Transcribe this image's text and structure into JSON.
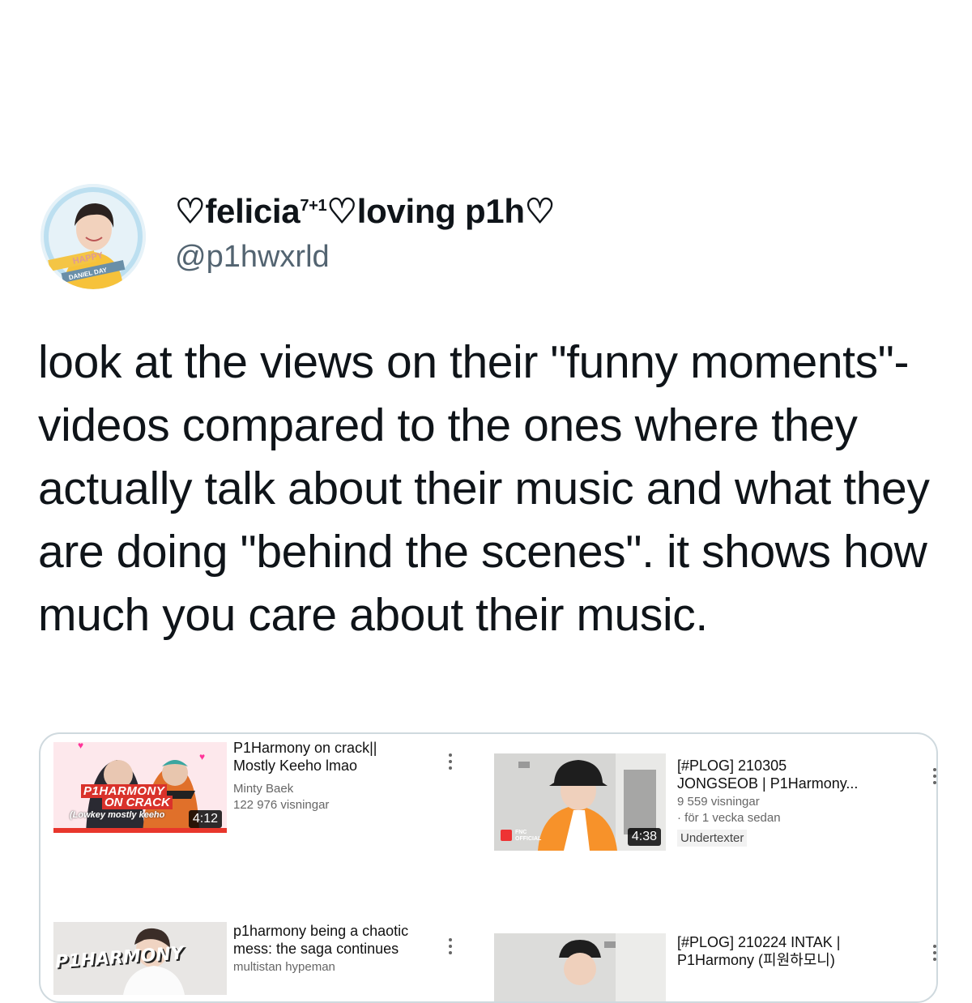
{
  "tweet": {
    "display_name": "♡felicia",
    "display_name_sup": "7+1",
    "display_name_rest": "♡loving p1h♡",
    "handle": "@p1hwxrld",
    "avatar_badge_top": "HAPPY",
    "avatar_badge_bottom": "DANIEL DAY",
    "text": "look at the views on their \"funny moments\"-videos compared to the ones where they actually talk about their music and what they are doing \"behind the scenes\". it shows how much you care about their music."
  },
  "videos": [
    {
      "title": "P1Harmony on crack||\nMostly Keeho lmao",
      "channel": "Minty Baek",
      "views": "122 976 visningar",
      "duration": "4:12",
      "overlay_line1": "P1HARMONY",
      "overlay_line2": "ON CRACK",
      "overlay_line3": "(Lowkey mostly keeho"
    },
    {
      "title": "[#PLOG] 210305\nJONGSEOB | P1Harmony...",
      "views": "9 559 visningar",
      "age": "· för 1 vecka sedan",
      "badge": "Undertexter",
      "duration": "4:38",
      "logo": "FNC\nOFFICIAL"
    },
    {
      "title": "p1harmony being a chaotic\nmess: the saga continues",
      "channel": "multistan hypeman",
      "overlay": "P1HARMONY"
    },
    {
      "title": "[#PLOG] 210224 INTAK |\nP1Harmony (피원하모니)"
    }
  ],
  "colors": {
    "handle": "#536471",
    "text": "#0f1419",
    "card_border": "#cfd9de",
    "overlay_red": "#d9322b"
  }
}
